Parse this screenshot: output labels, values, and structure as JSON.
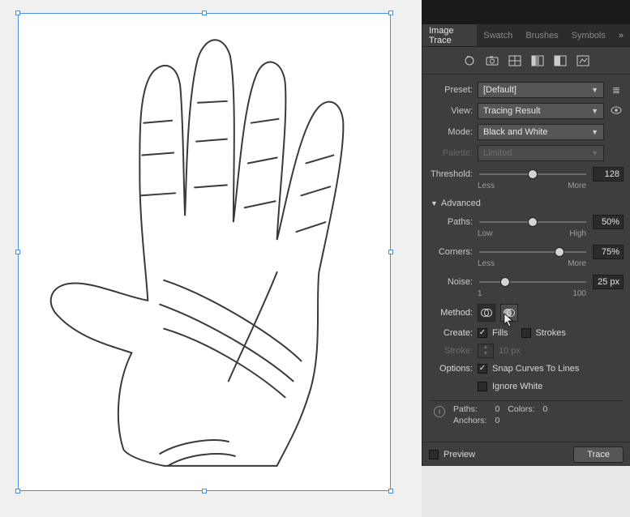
{
  "tabs": {
    "image_trace": "Image Trace",
    "swatches": "Swatch",
    "brushes": "Brushes",
    "symbols": "Symbols"
  },
  "icons": {
    "auto": "auto-color-icon",
    "camera": "camera-icon",
    "grid": "grid-icon",
    "gray": "grayscale-icon",
    "bw": "bw-icon",
    "outline": "outline-icon"
  },
  "preset": {
    "label": "Preset:",
    "value": "[Default]"
  },
  "view": {
    "label": "View:",
    "value": "Tracing Result"
  },
  "mode": {
    "label": "Mode:",
    "value": "Black and White"
  },
  "palette": {
    "label": "Palette:",
    "value": "Limited"
  },
  "threshold": {
    "label": "Threshold:",
    "value": "128",
    "low": "Less",
    "high": "More",
    "pos": 50
  },
  "advanced": {
    "label": "Advanced"
  },
  "paths": {
    "label": "Paths:",
    "value": "50%",
    "low": "Low",
    "high": "High",
    "pos": 50
  },
  "corners": {
    "label": "Corners:",
    "value": "75%",
    "low": "Less",
    "high": "More",
    "pos": 75
  },
  "noise": {
    "label": "Noise:",
    "value": "25 px",
    "low": "1",
    "high": "100",
    "pos": 24
  },
  "method": {
    "label": "Method:"
  },
  "create": {
    "label": "Create:",
    "fills_label": "Fills",
    "strokes_label": "Strokes",
    "fills_checked": true,
    "strokes_checked": false
  },
  "stroke": {
    "label": "Stroke:",
    "value": "10 px"
  },
  "options": {
    "label": "Options:",
    "snap_label": "Snap Curves To Lines",
    "snap_checked": true,
    "ignore_label": "Ignore White",
    "ignore_checked": false
  },
  "info": {
    "paths_label": "Paths:",
    "paths_value": "0",
    "colors_label": "Colors:",
    "colors_value": "0",
    "anchors_label": "Anchors:",
    "anchors_value": "0"
  },
  "footer": {
    "preview_label": "Preview",
    "preview_checked": false,
    "trace_label": "Trace"
  }
}
